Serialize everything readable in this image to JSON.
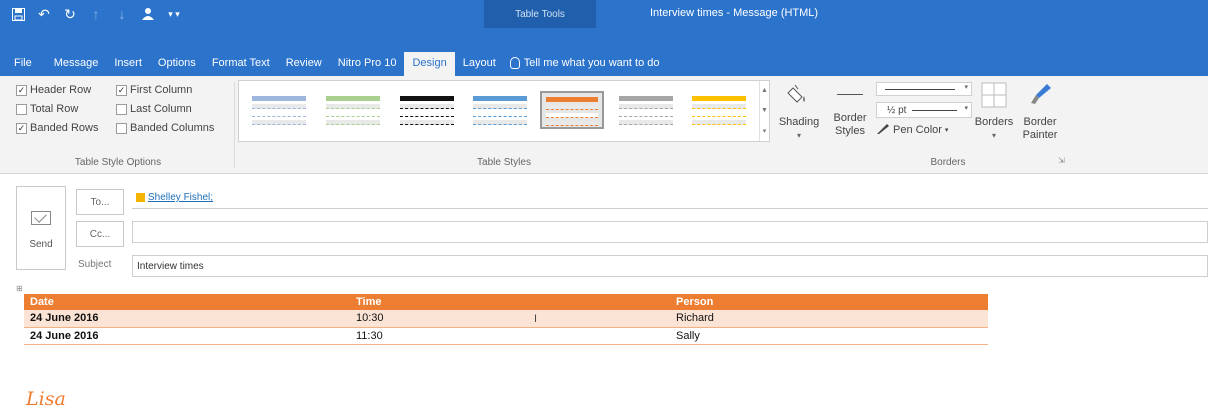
{
  "qat": {
    "icons": [
      "save-icon",
      "undo-icon",
      "redo-icon",
      "up-icon",
      "down-icon",
      "user-icon",
      "customize-icon"
    ],
    "contextual_label": "Table Tools",
    "window_title": "Interview times - Message (HTML)"
  },
  "tabs": [
    {
      "label": "File"
    },
    {
      "label": "Message"
    },
    {
      "label": "Insert"
    },
    {
      "label": "Options"
    },
    {
      "label": "Format Text"
    },
    {
      "label": "Review"
    },
    {
      "label": "Nitro Pro 10"
    },
    {
      "label": "Design",
      "active": true
    },
    {
      "label": "Layout"
    }
  ],
  "tell_me": "Tell me what you want to do",
  "ribbon": {
    "style_options": {
      "header_row": "Header Row",
      "total_row": "Total Row",
      "banded_rows": "Banded Rows",
      "first_column": "First Column",
      "last_column": "Last Column",
      "banded_columns": "Banded Columns",
      "group_label": "Table Style Options",
      "checked": {
        "header_row": true,
        "total_row": false,
        "banded_rows": true,
        "first_column": true,
        "last_column": false,
        "banded_columns": false
      }
    },
    "table_styles": {
      "group_label": "Table Styles",
      "swatch_colors": [
        "#9db7dc",
        "#a9d08e",
        "#111111",
        "#5b9bd5",
        "#ed7d31",
        "#a5a5a5",
        "#ffc000"
      ],
      "selected_index": 4
    },
    "shading": {
      "label": "Shading"
    },
    "border_styles": {
      "line1": "Border",
      "line2": "Styles"
    },
    "pen_weight": "½ pt",
    "pen_color": "Pen Color",
    "borders": {
      "line1": "Borders"
    },
    "border_painter": {
      "line1": "Border",
      "line2": "Painter"
    },
    "borders_group_label": "Borders"
  },
  "message": {
    "send_label": "Send",
    "to_label": "To...",
    "cc_label": "Cc...",
    "subject_label": "Subject",
    "recipient": "Shelley Fishel;",
    "subject": "Interview times"
  },
  "table": {
    "headers": [
      "Date",
      "Time",
      "Person"
    ],
    "rows": [
      [
        "24 June 2016",
        "10:30",
        "Richard"
      ],
      [
        "24 June 2016",
        "11:30",
        "Sally"
      ]
    ]
  },
  "signature": "Lisa"
}
